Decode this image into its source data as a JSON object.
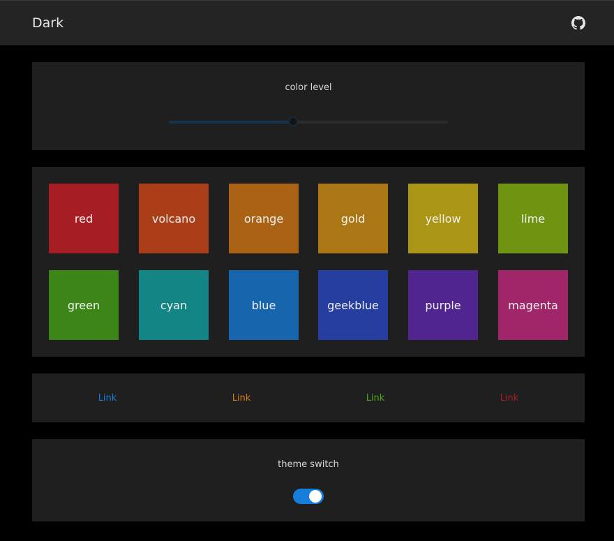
{
  "header": {
    "title": "Dark",
    "icon": "github-icon"
  },
  "level_card": {
    "label": "color level",
    "slider_value": 0.445
  },
  "colors": [
    {
      "name": "red",
      "color": "#a61d24"
    },
    {
      "name": "volcano",
      "color": "#aa3e19"
    },
    {
      "name": "orange",
      "color": "#aa6215"
    },
    {
      "name": "gold",
      "color": "#aa7714"
    },
    {
      "name": "yellow",
      "color": "#aa9514"
    },
    {
      "name": "lime",
      "color": "#6f9412"
    },
    {
      "name": "green",
      "color": "#3c8618"
    },
    {
      "name": "cyan",
      "color": "#138585"
    },
    {
      "name": "blue",
      "color": "#1765ad"
    },
    {
      "name": "geekblue",
      "color": "#263ea0"
    },
    {
      "name": "purple",
      "color": "#51258f"
    },
    {
      "name": "magenta",
      "color": "#a02669"
    }
  ],
  "links": [
    {
      "label": "Link",
      "color": "#177ddc"
    },
    {
      "label": "Link",
      "color": "#d87a16"
    },
    {
      "label": "Link",
      "color": "#49aa19"
    },
    {
      "label": "Link",
      "color": "#a61d24"
    }
  ],
  "theme_card": {
    "label": "theme switch",
    "switch_on": true
  }
}
